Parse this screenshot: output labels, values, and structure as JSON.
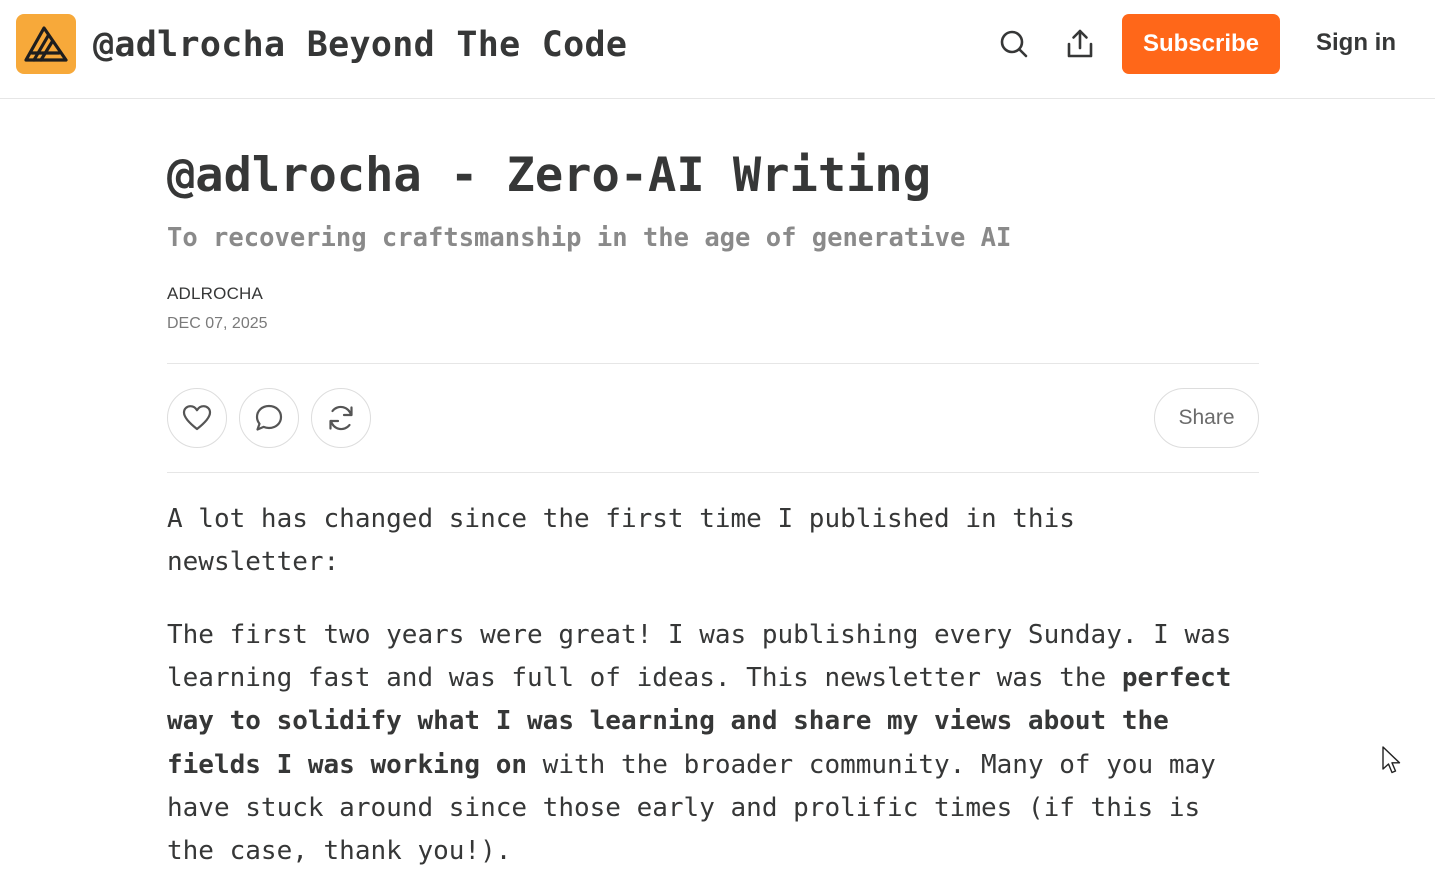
{
  "header": {
    "site_title": "@adlrocha Beyond The Code",
    "subscribe_label": "Subscribe",
    "signin_label": "Sign in",
    "icons": [
      "logo-icon",
      "search-icon",
      "share-upload-icon"
    ]
  },
  "post": {
    "title": "@adlrocha - Zero-AI Writing",
    "subtitle": "To recovering craftsmanship in the age of generative AI",
    "author": "ADLROCHA",
    "date": "DEC 07, 2025"
  },
  "actions": {
    "icons": [
      "heart-icon",
      "comment-icon",
      "restack-icon"
    ],
    "share_label": "Share"
  },
  "body": {
    "p1": "A lot has changed since the first time I published in this newsletter:",
    "p2_start": "The first two years were great! I was publishing every Sunday. I was learning fast and was full of ideas. This newsletter was the ",
    "p2_bold": "perfect way to solidify what I was learning and share my views about the fields I was working on",
    "p2_end": " with the broader community. Many of you may have stuck around since those early and prolific times (if this is the case, thank you!)."
  },
  "colors": {
    "accent": "#ff6719",
    "logo_bg": "#f7a93a",
    "text": "#363737",
    "muted": "#8a8a8a",
    "border": "#e6e6e6"
  }
}
